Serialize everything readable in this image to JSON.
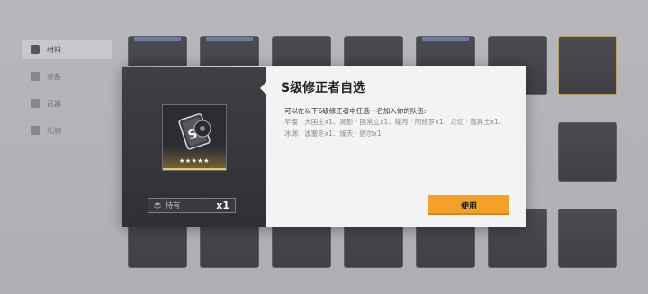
{
  "sidebar": {
    "items": [
      {
        "label": "材料"
      },
      {
        "label": "装备"
      },
      {
        "label": "武器"
      },
      {
        "label": "礼物"
      }
    ]
  },
  "dialog": {
    "title": "S级修正者自选",
    "subtitle": "可以在以下S级修正者中任选一名加入你的队伍:",
    "description": "早樱 · 大国主x1、晃影 · 国常立x1、瞳月 · 阿修罗x1、龙切 · 迦具土x1、冰渊 · 波塞冬x1、燥天 · 提尔x1",
    "stars": "★★★★★",
    "own_label": "持有",
    "own_count": "x1",
    "use_label": "使用"
  },
  "colors": {
    "accent": "#f3a227",
    "rarity_gold": "#f0c85a"
  }
}
